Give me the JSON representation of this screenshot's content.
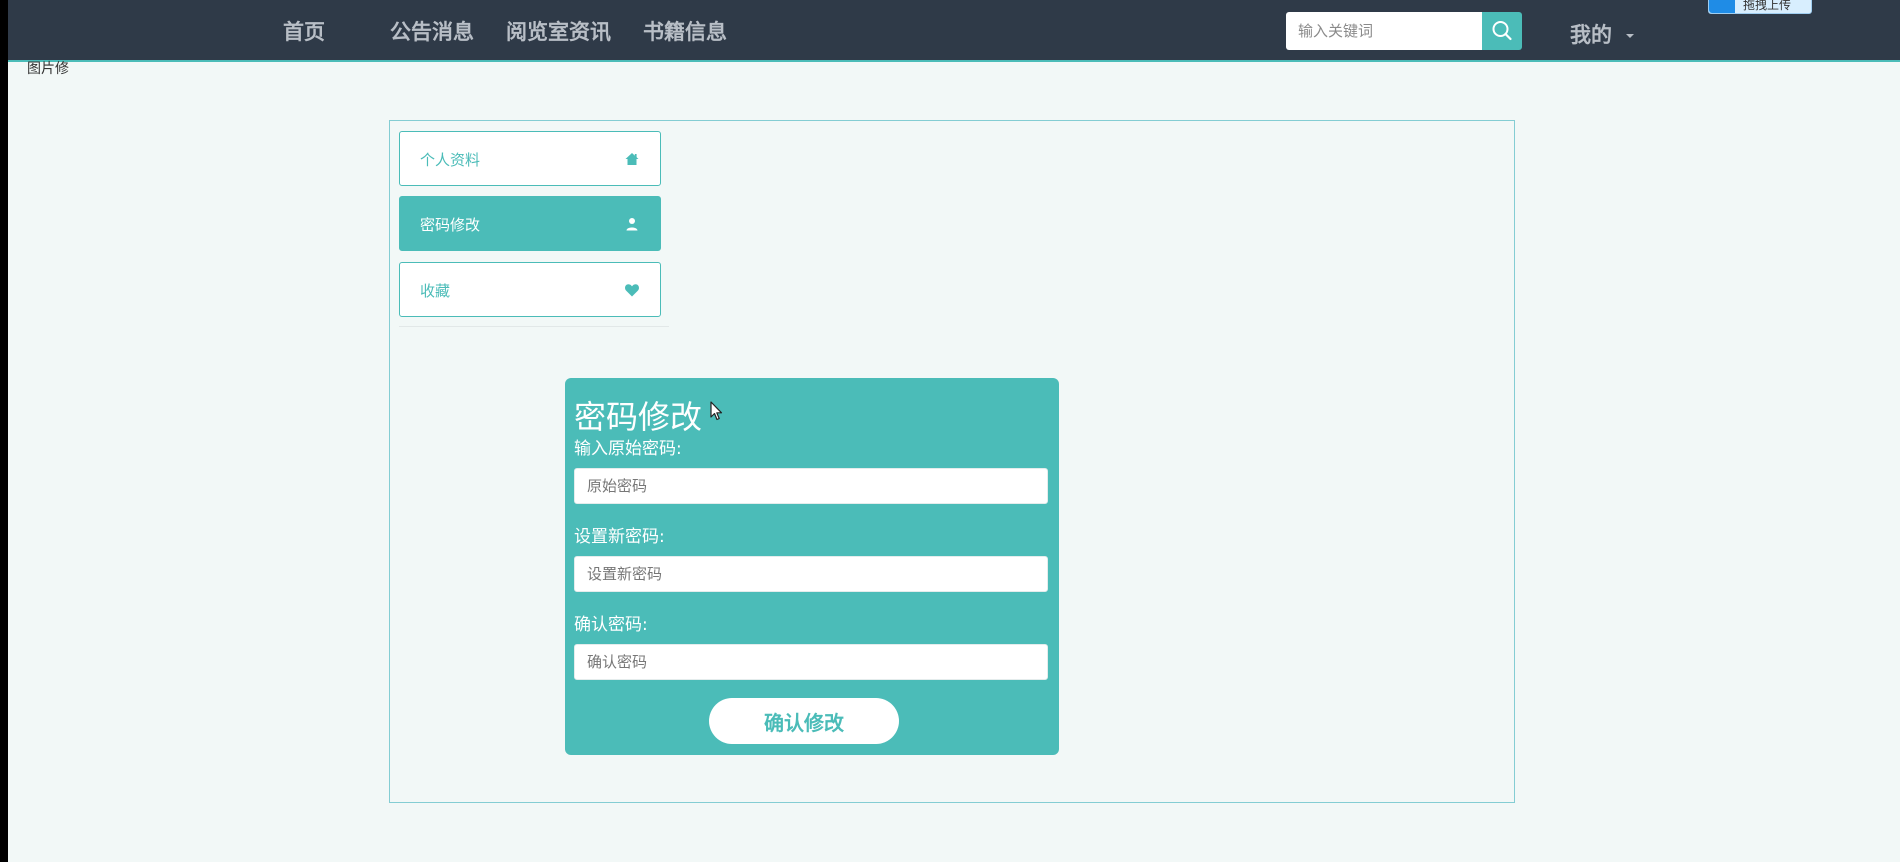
{
  "nav": {
    "links": [
      {
        "label": "首页"
      },
      {
        "label": "公告消息"
      },
      {
        "label": "阅览室资讯"
      },
      {
        "label": "书籍信息"
      }
    ],
    "search_placeholder": "输入关键词",
    "search_icon": "search-icon",
    "mine_label": "我的"
  },
  "upload_widget": {
    "label": "拖拽上传"
  },
  "stray_text": "图片修",
  "sidebar": {
    "items": [
      {
        "label": "个人资料",
        "icon": "home-icon",
        "active": false
      },
      {
        "label": "密码修改",
        "icon": "user-icon",
        "active": true
      },
      {
        "label": "收藏",
        "icon": "heart-icon",
        "active": false
      }
    ]
  },
  "form": {
    "title": "密码修改",
    "fields": [
      {
        "label": "输入原始密码:",
        "placeholder": "原始密码",
        "value": ""
      },
      {
        "label": "设置新密码:",
        "placeholder": "设置新密码",
        "value": ""
      },
      {
        "label": "确认密码:",
        "placeholder": "确认密码",
        "value": ""
      }
    ],
    "submit_label": "确认修改"
  },
  "colors": {
    "accent": "#4bbcb8",
    "nav_bg": "#2f3a48",
    "page_bg": "#f2f8f7"
  }
}
